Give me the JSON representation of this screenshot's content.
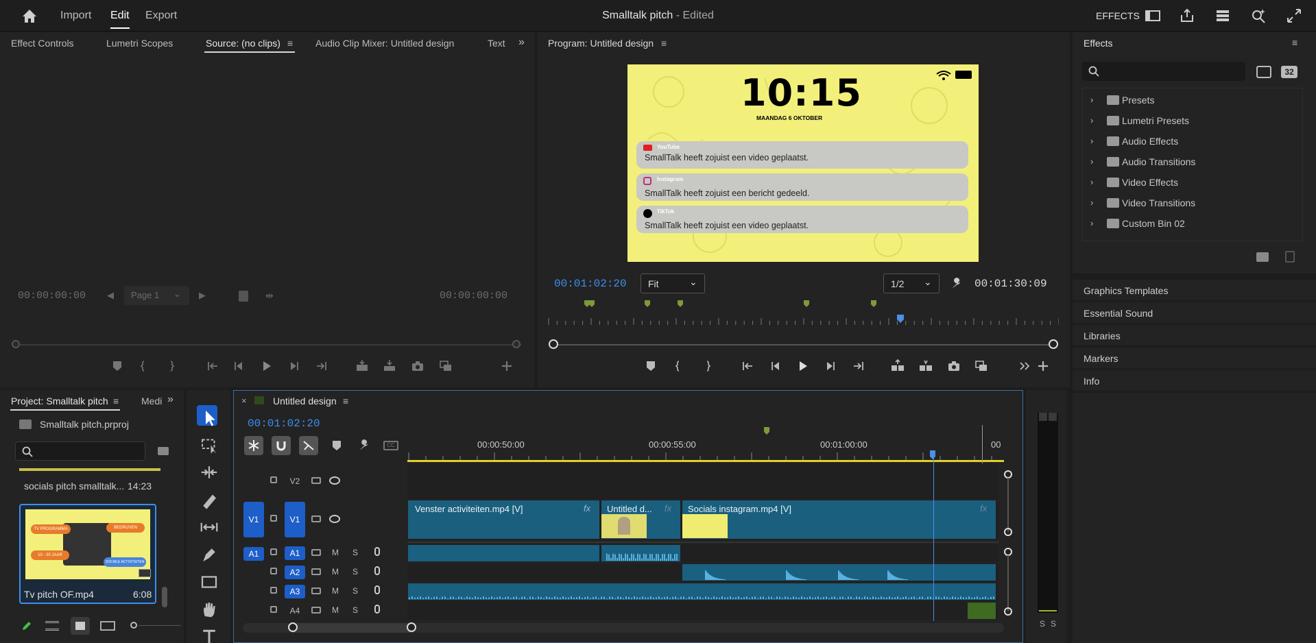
{
  "topbar": {
    "nav": [
      "Import",
      "Edit",
      "Export"
    ],
    "active_nav": "Edit",
    "project_title": "Smalltalk pitch",
    "edited": "- Edited",
    "workspace": "EFFECTS"
  },
  "source_panel": {
    "tabs": [
      "Effect Controls",
      "Lumetri Scopes",
      "Source: (no clips)",
      "Audio Clip Mixer: Untitled design",
      "Text"
    ],
    "active_tab": "Source: (no clips)",
    "timecode_in": "00:00:00:00",
    "timecode_out": "00:00:00:00",
    "page": "Page 1"
  },
  "program_panel": {
    "title": "Program: Untitled design",
    "timecode": "00:01:02:20",
    "fit": "Fit",
    "resolution": "1/2",
    "duration": "00:01:30:09"
  },
  "preview": {
    "clock": "10:15",
    "date": "MAANDAG 6 OKTOBER",
    "notifications": [
      {
        "app": "YouTube",
        "message": "SmallTalk heeft zojuist een video geplaatst."
      },
      {
        "app": "Instagram",
        "message": "SmallTalk heeft zojuist een bericht gedeeld."
      },
      {
        "app": "TikTok",
        "message": "SmallTalk heeft zojuist een video geplaatst."
      }
    ],
    "bg_color": "#f2f07a"
  },
  "effects_panel": {
    "title": "Effects",
    "items": [
      "Presets",
      "Lumetri Presets",
      "Audio Effects",
      "Audio Transitions",
      "Video Effects",
      "Video Transitions",
      "Custom Bin 02"
    ],
    "icon_32": "32"
  },
  "side_panels": [
    "Graphics Templates",
    "Essential Sound",
    "Libraries",
    "Markers",
    "Info"
  ],
  "project_panel": {
    "tab": "Project: Smalltalk pitch",
    "tab2": "Medi",
    "file": "Smalltalk pitch.prproj",
    "items": [
      {
        "name": "socials pitch smalltalk...",
        "duration": "14:23"
      },
      {
        "name": "Tv pitch OF.mp4",
        "duration": "6:08"
      }
    ],
    "thumb_tags": [
      "TV PROGRAMMA",
      "BEDRIJVEN",
      "10 - 30 JAAR",
      "SOCIALE ACTIVITEITEN"
    ]
  },
  "timeline": {
    "sequence": "Untitled design",
    "timecode": "00:01:02:20",
    "ruler": [
      "00:00:50:00",
      "00:00:55:00",
      "00:01:00:00",
      "00"
    ],
    "tracks_video": [
      "V2",
      "V1"
    ],
    "tracks_audio": [
      "A1",
      "A2",
      "A3",
      "A4"
    ],
    "source_video": "V1",
    "source_audio": "A1",
    "mute": "M",
    "solo": "S",
    "clips": [
      {
        "name": "Venster activiteiten.mp4 [V]",
        "fx": "fx"
      },
      {
        "name": "Untitled d...",
        "fx": "fx"
      },
      {
        "name": "Socials instagram.mp4 [V]",
        "fx": "fx"
      }
    ]
  },
  "audio_meter": {
    "labels": [
      "S",
      "S"
    ]
  },
  "colors": {
    "accent_blue": "#2d8ceb",
    "clip_video": "#1b5f7e",
    "clip_audio": "#1a6080",
    "playhead": "#4a8fe8",
    "marker": "#7f9a3a"
  }
}
